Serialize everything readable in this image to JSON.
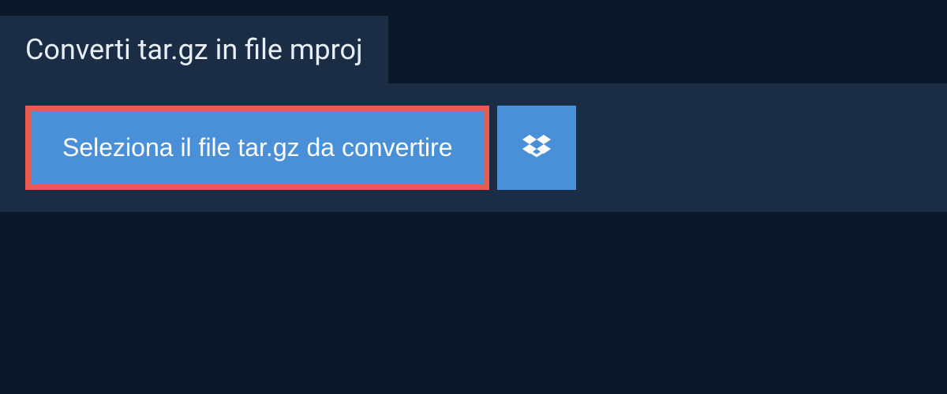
{
  "header": {
    "title": "Converti tar.gz in file mproj"
  },
  "actions": {
    "select_file_label": "Seleziona il file tar.gz da convertire"
  },
  "colors": {
    "background": "#0a1829",
    "panel": "#1a2d45",
    "button": "#4a90d9",
    "highlight_border": "#e85a4f",
    "text_light": "#e8eef5",
    "text_white": "#ffffff"
  }
}
